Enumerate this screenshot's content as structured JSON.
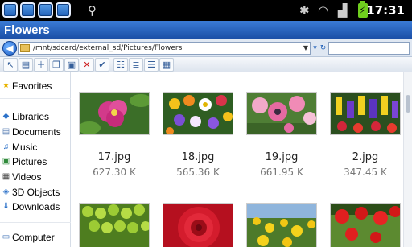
{
  "statusbar": {
    "time": "17:31",
    "battery_icon": "battery-charging-icon"
  },
  "window": {
    "title": "Flowers"
  },
  "address": {
    "path": "/mnt/sdcard/external_sd/Pictures/Flowers"
  },
  "navigation": {
    "favorites": "Favorites",
    "libraries": "Libraries",
    "items": [
      "Documents",
      "Music",
      "Pictures",
      "Videos",
      "3D Objects",
      "Downloads"
    ],
    "computer": "Computer"
  },
  "files": [
    {
      "name": "17.jpg",
      "size": "627.30 K"
    },
    {
      "name": "18.jpg",
      "size": "565.36 K"
    },
    {
      "name": "19.jpg",
      "size": "661.95 K"
    },
    {
      "name": "2.jpg",
      "size": "347.45 K"
    }
  ]
}
